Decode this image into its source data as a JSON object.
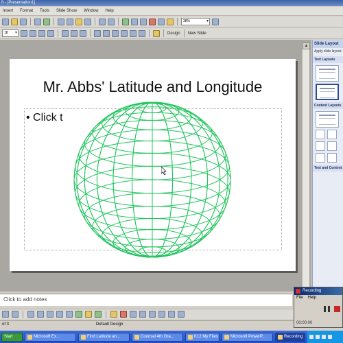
{
  "window": {
    "title": "ft - [Presentation1]"
  },
  "menu": [
    "Insert",
    "Format",
    "Tools",
    "Slide Show",
    "Window",
    "Help"
  ],
  "toolbar": {
    "zoom": "38%",
    "font_size": "18",
    "design_label": "Design",
    "new_slide_label": "New Slide"
  },
  "slide": {
    "title": "Mr. Abbs' Latitude and Longitude",
    "bullet": "Click t"
  },
  "taskpane": {
    "header": "Slide Layout",
    "apply_label": "Apply slide layout:",
    "text_layouts": "Text Layouts",
    "content_layouts": "Content Layouts",
    "text_content_layouts": "Text and Content Layouts"
  },
  "notes": {
    "placeholder": "Click to add notes"
  },
  "statusbar": {
    "slide_counter": "of 3",
    "design": "Default Design"
  },
  "recorder": {
    "title": "Recording",
    "menu": [
      "File",
      "Help"
    ],
    "time": "00:00:00"
  },
  "taskbar": {
    "items": [
      {
        "label": "Start"
      },
      {
        "label": "Microsoft Ex..."
      },
      {
        "label": "Find Latitude an..."
      },
      {
        "label": "Counsel 4th Gra..."
      },
      {
        "label": "K12 My Files"
      },
      {
        "label": "Microsoft PowerP..."
      },
      {
        "label": "Recording"
      }
    ]
  },
  "colors": {
    "globe": "#22c55e",
    "titlebar": "#3b63a8",
    "taskbar": "#2453c8"
  },
  "icons": [
    "new-icon",
    "open-icon",
    "save-icon",
    "print-icon",
    "cut-icon",
    "copy-icon",
    "paste-icon",
    "undo-icon",
    "bold-icon",
    "italic-icon",
    "underline-icon",
    "align-icon",
    "pause-icon",
    "stop-icon"
  ]
}
